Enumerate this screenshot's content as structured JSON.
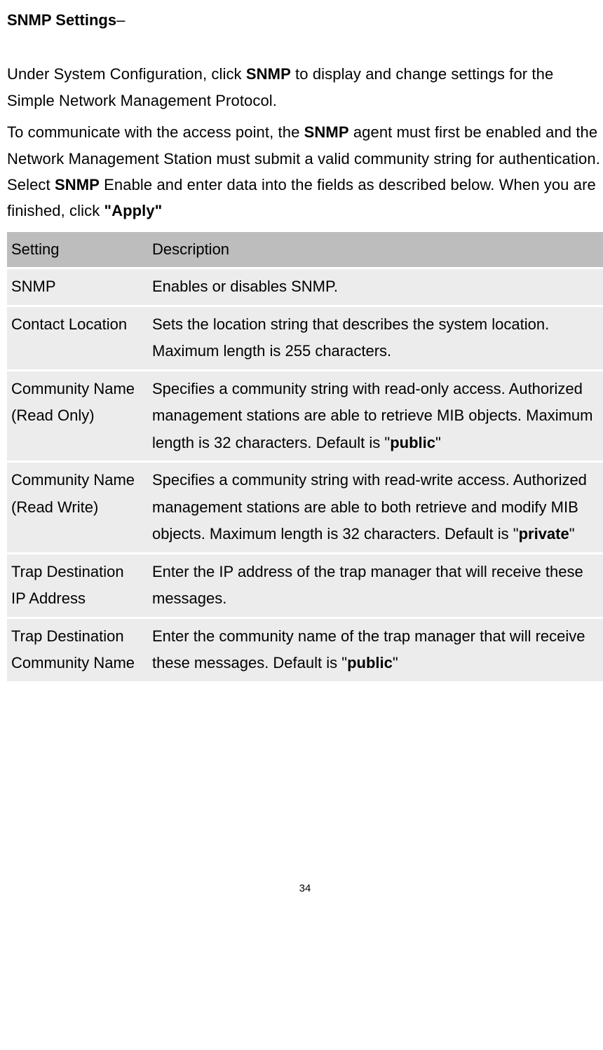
{
  "heading": {
    "title": "SNMP Settings",
    "dash": "–"
  },
  "para1": {
    "p1": "Under System Configuration, click ",
    "b1": "SNMP",
    "p2": " to display and change settings for the Simple Network Management Protocol."
  },
  "para2": {
    "p1": "To communicate with the access point, the ",
    "b1": "SNMP",
    "p2": " agent must first be enabled and the Network Management Station must submit a valid community string for authentication. Select ",
    "b2": "SNMP",
    "p3": " Enable and enter data into the fields as described below. When you are finished, click ",
    "b3": "\"Apply\""
  },
  "table": {
    "header": {
      "col1": "Setting",
      "col2": "Description"
    },
    "rows": [
      {
        "setting": "SNMP",
        "desc_plain": "Enables or disables SNMP."
      },
      {
        "setting": "Contact Location",
        "desc_plain": "Sets the location string that describes the system location. Maximum length is 255 characters."
      },
      {
        "setting": "Community Name (Read Only)",
        "desc_pre": "Specifies a community string with read-only access. Authorized management stations are able to retrieve MIB objects. Maximum length is 32 characters. Default is \"",
        "desc_bold": "public",
        "desc_post": "\""
      },
      {
        "setting": "Community Name (Read Write)",
        "desc_pre": "Specifies a community string with read-write access. Authorized management stations are able to both retrieve and modify MIB objects. Maximum length is 32 characters. Default is \"",
        "desc_bold": "private",
        "desc_post": "\""
      },
      {
        "setting": "Trap Destination IP Address",
        "desc_plain": "Enter the IP address of the trap manager that will receive these messages."
      },
      {
        "setting": "Trap Destination Community Name",
        "desc_pre": "Enter the community name of the trap manager that will receive these messages. Default is \"",
        "desc_bold": "public",
        "desc_post": "\""
      }
    ]
  },
  "page_number": "34"
}
